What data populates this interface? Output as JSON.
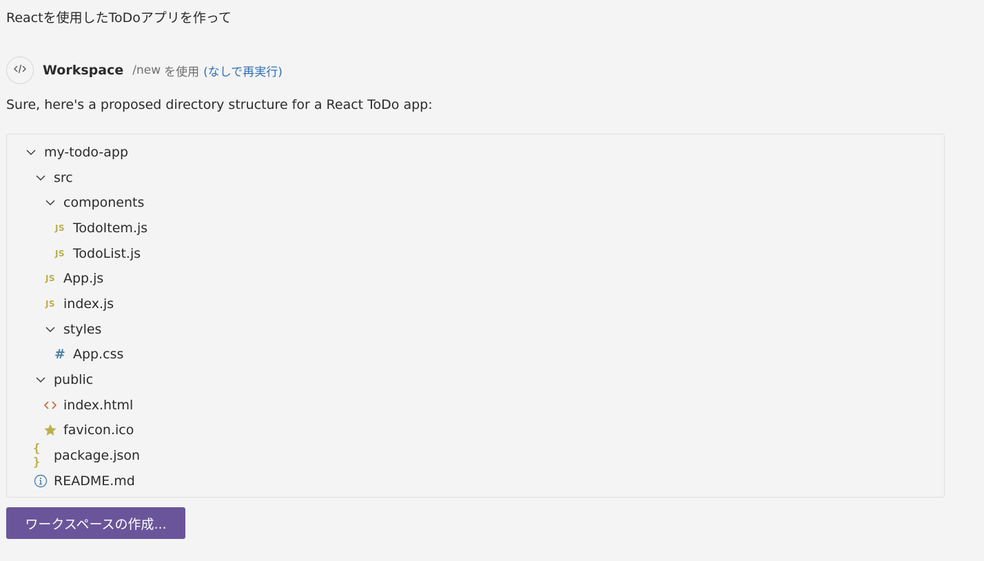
{
  "user_message": "Reactを使用したToDoアプリを作って",
  "agent": {
    "name": "Workspace",
    "command": "/new",
    "command_suffix": "を使用",
    "rerun_link": "(なしで再実行)",
    "avatar_icon": "code-icon"
  },
  "response_text": "Sure, here's a proposed directory structure for a React ToDo app:",
  "tree": [
    {
      "label": "my-todo-app",
      "icon": "chevron-down-icon",
      "depth": 0
    },
    {
      "label": "src",
      "icon": "chevron-down-icon",
      "depth": 1
    },
    {
      "label": "components",
      "icon": "chevron-down-icon",
      "depth": 2
    },
    {
      "label": "TodoItem.js",
      "icon": "js-file-icon",
      "depth": 3
    },
    {
      "label": "TodoList.js",
      "icon": "js-file-icon",
      "depth": 3
    },
    {
      "label": "App.js",
      "icon": "js-file-icon",
      "depth": 2
    },
    {
      "label": "index.js",
      "icon": "js-file-icon",
      "depth": 2
    },
    {
      "label": "styles",
      "icon": "chevron-down-icon",
      "depth": 2
    },
    {
      "label": "App.css",
      "icon": "css-file-icon",
      "depth": 3
    },
    {
      "label": "public",
      "icon": "chevron-down-icon",
      "depth": 1
    },
    {
      "label": "index.html",
      "icon": "html-file-icon",
      "depth": 2
    },
    {
      "label": "favicon.ico",
      "icon": "star-icon",
      "depth": 2
    },
    {
      "label": "package.json",
      "icon": "json-file-icon",
      "depth": 1
    },
    {
      "label": "README.md",
      "icon": "info-icon",
      "depth": 1
    }
  ],
  "icon_glyphs": {
    "js": "JS",
    "css": "#",
    "json": "{ }"
  },
  "create_button_label": "ワークスペースの作成...",
  "colors": {
    "background": "#f4f4f4",
    "button": "#6b559a",
    "link": "#2f6fb5",
    "js_icon": "#b8b04a",
    "css_icon": "#4f7fa8",
    "html_icon": "#c6673a",
    "info_icon": "#4f7fa8"
  }
}
